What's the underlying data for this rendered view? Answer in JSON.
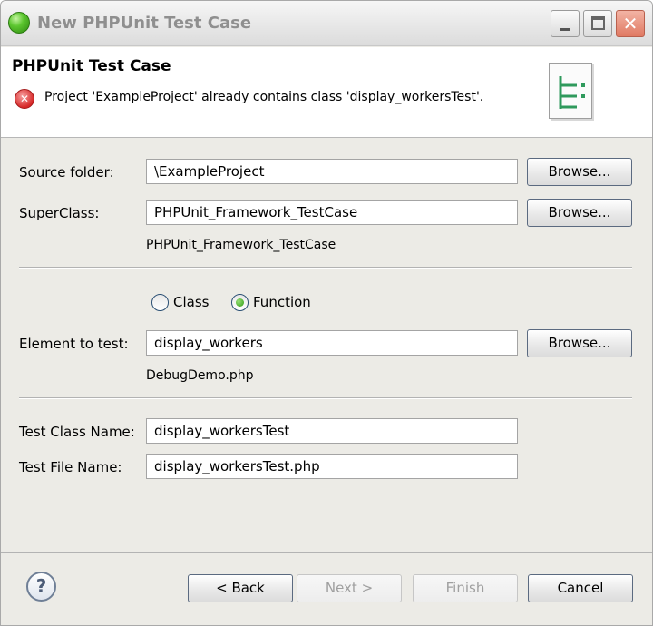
{
  "window": {
    "title": "New PHPUnit Test Case"
  },
  "banner": {
    "title": "PHPUnit Test Case",
    "error_message": "Project 'ExampleProject' already contains class 'display_workersTest'."
  },
  "form": {
    "source_folder": {
      "label": "Source folder:",
      "value": "\\ExampleProject",
      "browse_label": "Browse..."
    },
    "superclass": {
      "label": "SuperClass:",
      "value": "PHPUnit_Framework_TestCase",
      "browse_label": "Browse...",
      "hint": "PHPUnit_Framework_TestCase"
    },
    "test_type": {
      "options": [
        "Class",
        "Function"
      ],
      "selected": "Function"
    },
    "element_to_test": {
      "label": "Element to test:",
      "value": "display_workers",
      "browse_label": "Browse...",
      "hint": "DebugDemo.php"
    },
    "test_class_name": {
      "label": "Test Class Name:",
      "value": "display_workersTest"
    },
    "test_file_name": {
      "label": "Test File Name:",
      "value": "display_workersTest.php"
    }
  },
  "footer": {
    "back_label": "< Back",
    "next_label": "Next >",
    "finish_label": "Finish",
    "cancel_label": "Cancel"
  },
  "icons": {
    "app": "eclipse-icon",
    "error": "error-icon",
    "help": "help-icon",
    "wizard": "unit-test-wizard-icon"
  },
  "colors": {
    "dialog_bg": "#ecebe6",
    "error_red": "#d62828",
    "radio_selected": "#2e9c12"
  }
}
